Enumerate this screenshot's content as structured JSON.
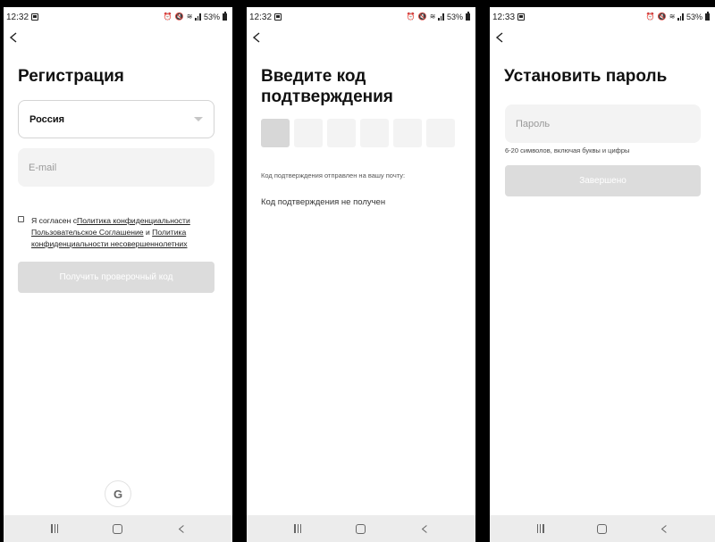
{
  "screens": [
    {
      "status": {
        "time": "12:32",
        "battery": "53%"
      },
      "title": "Регистрация",
      "country": "Россия",
      "email_placeholder": "E-mail",
      "agree": {
        "prefix": "Я согласен с",
        "privacy_link": "Политика конфиденциальности",
        "terms_link": "Пользовательское Соглашение",
        "and": " и ",
        "minors_link": "Политика конфиденциальности несовершеннолетних"
      },
      "button": "Получить проверочный код",
      "google": "G"
    },
    {
      "status": {
        "time": "12:32",
        "battery": "53%"
      },
      "title": "Введите код подтверждения",
      "code_sent": "Код подтверждения отправлен на вашу почту:",
      "not_received": "Код подтверждения не получен"
    },
    {
      "status": {
        "time": "12:33",
        "battery": "53%"
      },
      "title": "Установить пароль",
      "password_placeholder": "Пароль",
      "hint": "6-20 символов, включая буквы и цифры",
      "button": "Завершено"
    }
  ],
  "icons": [
    "alarm-icon",
    "mute-icon",
    "wifi-icon",
    "signal-icon",
    "battery-icon",
    "back-icon",
    "recent-apps-icon",
    "home-icon",
    "nav-back-icon",
    "google-icon"
  ],
  "colors": {
    "disabled_button": "#dcdcdc",
    "field_bg": "#f3f3f3",
    "nav_bar": "#ececec"
  }
}
